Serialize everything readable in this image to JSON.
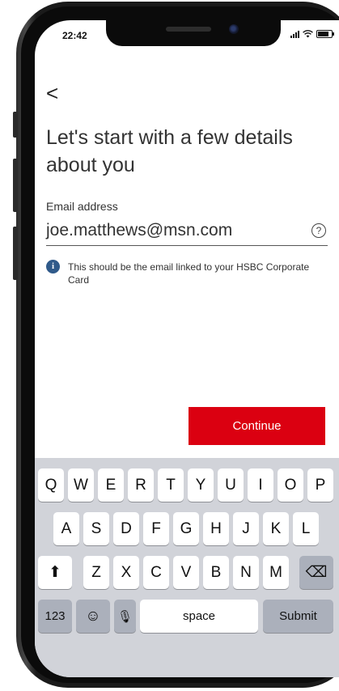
{
  "status_bar": {
    "time": "22:42"
  },
  "nav": {
    "back_glyph": "<"
  },
  "title": "Let's start with a few details about you",
  "email": {
    "label": "Email address",
    "value": "joe.matthews@msn.com",
    "help_glyph": "?"
  },
  "info": {
    "icon_glyph": "i",
    "text": "This should be the email linked to your HSBC Corporate Card"
  },
  "continue_label": "Continue",
  "colors": {
    "brand_red": "#db0011",
    "info_blue": "#305a8a"
  },
  "keyboard": {
    "row1": [
      "Q",
      "W",
      "E",
      "R",
      "T",
      "Y",
      "U",
      "I",
      "O",
      "P"
    ],
    "row2": [
      "A",
      "S",
      "D",
      "F",
      "G",
      "H",
      "J",
      "K",
      "L"
    ],
    "row3": [
      "Z",
      "X",
      "C",
      "V",
      "B",
      "N",
      "M"
    ],
    "shift_glyph": "⬆",
    "backspace_glyph": "⌫",
    "numbers_label": "123",
    "emoji_glyph": "☺",
    "mic_glyph": "🎙",
    "space_label": "space",
    "submit_label": "Submit"
  }
}
